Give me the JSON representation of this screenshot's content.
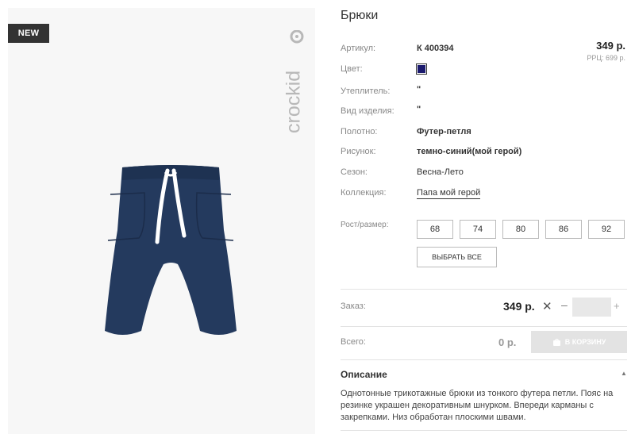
{
  "product": {
    "badge": "NEW",
    "brand_logo": "crockid",
    "title": "Брюки"
  },
  "attributes": [
    {
      "label": "Артикул:",
      "value": "К 400394"
    },
    {
      "label": "Цвет:",
      "value": ""
    },
    {
      "label": "Утеплитель:",
      "value": "\""
    },
    {
      "label": "Вид изделия:",
      "value": "\""
    },
    {
      "label": "Полотно:",
      "value": "Футер-петля"
    },
    {
      "label": "Рисунок:",
      "value": "темно-синий(мой герой)"
    },
    {
      "label": "Сезон:",
      "value": "Весна-Лето"
    },
    {
      "label": "Коллекция:",
      "value": "Папа мой герой"
    }
  ],
  "colors": {
    "swatch": "#1b1a6e",
    "garment": "#243a5e"
  },
  "pricing": {
    "price": "349 р.",
    "rrp": "РРЦ: 699 р."
  },
  "sizes": {
    "label": "Рост/размер:",
    "options": [
      "68",
      "74",
      "80",
      "86",
      "92"
    ],
    "select_all": "ВЫБРАТЬ ВСЕ"
  },
  "order": {
    "label": "Заказ:",
    "price": "349 р.",
    "remove": "✕",
    "minus": "–",
    "plus": "+",
    "quantity": ""
  },
  "total": {
    "label": "Всего:",
    "value": "0 р.",
    "cart_button": "В КОРЗИНУ"
  },
  "description": {
    "title": "Описание",
    "text": "Однотонные трикотажные брюки из тонкого футера петли. Пояс на резинке украшен декоративным шнурком. Впереди карманы с закрепками. Низ обработан плоскими швами."
  }
}
